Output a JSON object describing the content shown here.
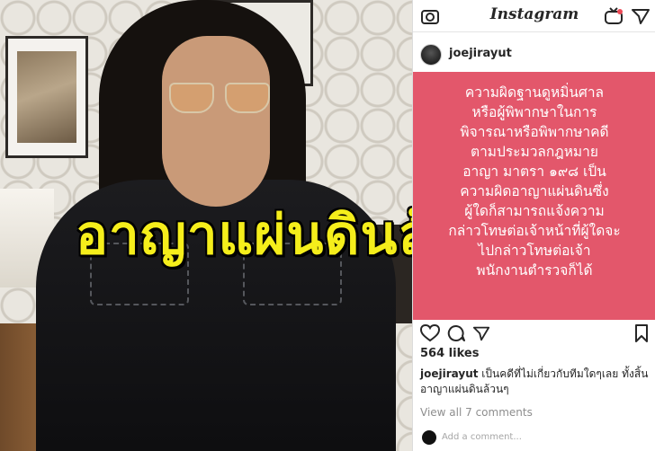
{
  "overlay": {
    "headline": "อาญาแผ่นดินล้วนๆ"
  },
  "instagram": {
    "brand": "Instagram",
    "username": "joejirayut",
    "post_lines": [
      "ความผิดฐานดูหมิ่นศาล",
      "หรือผู้พิพากษาในการ",
      "พิจารณาหรือพิพากษาคดี",
      "ตามประมวลกฎหมาย",
      "อาญา มาตรา ๑๙๘ เป็น",
      "ความผิดอาญาแผ่นดินซึ่ง",
      "ผู้ใดก็สามารถแจ้งความ",
      "กล่าวโทษต่อเจ้าหน้าที่ผู้ใดจะ",
      "ไปกล่าวโทษต่อเจ้า",
      "พนักงานตำรวจก็ได้"
    ],
    "likes": "564 likes",
    "caption_user": "joejirayut",
    "caption_text": " เป็นคดีที่ไม่เกี่ยวกับทีมใดๆเลย ทั้งสิ้น อาญาแผ่นดินล้วนๆ",
    "view_comments": "View all 7 comments",
    "add_comment_placeholder": "Add a comment...",
    "post_bg_color": "#e3576b"
  }
}
